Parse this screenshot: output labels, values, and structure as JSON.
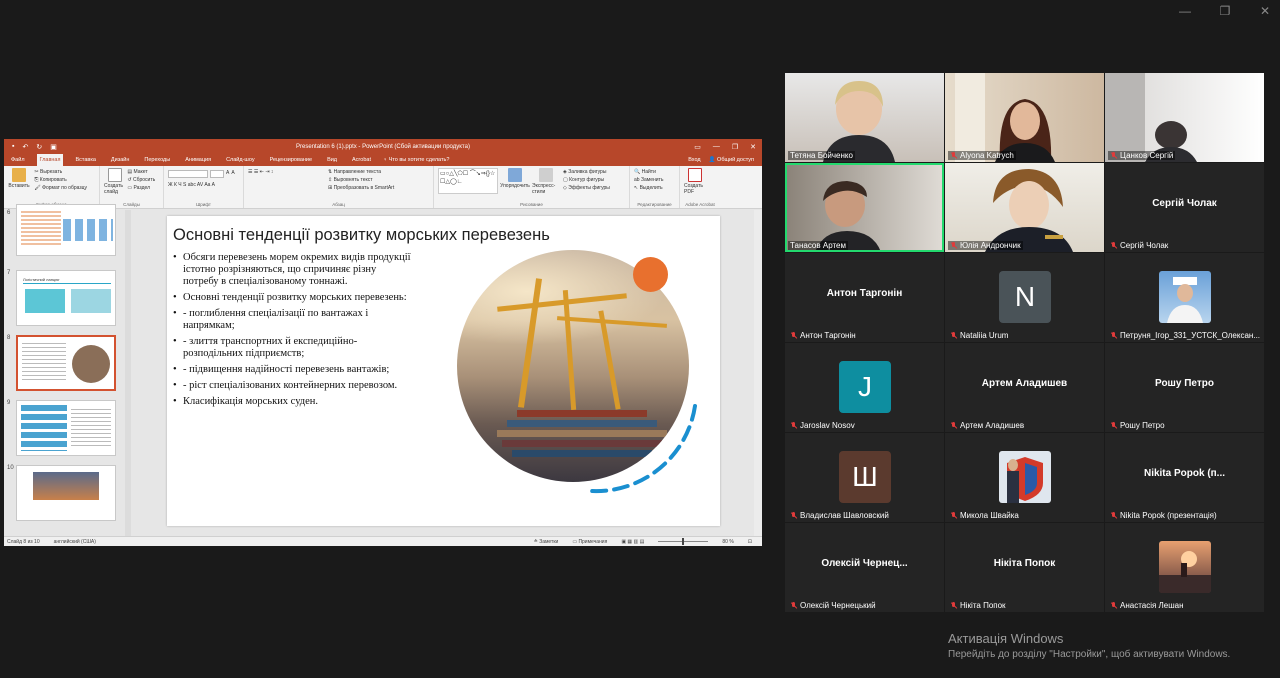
{
  "window": {
    "minimize": "—",
    "maximize": "❐",
    "close": "✕"
  },
  "ppt": {
    "title": "Presentation 6 (1).pptx - PowerPoint (Сбой активации продукта)",
    "menu_tabs": [
      "Файл",
      "Главная",
      "Вставка",
      "Дизайн",
      "Переходы",
      "Анимация",
      "Слайд-шоу",
      "Рецензирование",
      "Вид",
      "Acrobat"
    ],
    "active_tab": "Главная",
    "tell_me": "Что вы хотите сделать?",
    "login": "Вход",
    "share": "Общий доступ",
    "ribbon": {
      "paste": "Вставить",
      "cut": "Вырезать",
      "copy": "Копировать",
      "format_painter": "Формат по образцу",
      "clipboard_group": "Буфер обмена",
      "new_slide": "Создать слайд",
      "layout": "Макет",
      "reset": "Сбросить",
      "section": "Раздел",
      "slides_group": "Слайды",
      "font_group": "Шрифт",
      "text_direction": "Направление текста",
      "align_text": "Выровнять текст",
      "smartart": "Преобразовать в SmartArt",
      "paragraph_group": "Абзац",
      "arrange": "Упорядочить",
      "quick_styles": "Экспресс-стили",
      "shape_fill": "Заливка фигуры",
      "shape_outline": "Контур фигуры",
      "shape_effects": "Эффекты фигуры",
      "drawing_group": "Рисование",
      "find": "Найти",
      "replace": "Заменить",
      "select": "Выделить",
      "editing_group": "Редактирование",
      "create_pdf": "Создать PDF",
      "acrobat_group": "Adobe Acrobat"
    },
    "thumbs": [
      {
        "num": "7",
        "caption": "Логістичний ланцюг"
      },
      {
        "num": "8",
        "caption": ""
      },
      {
        "num": "9",
        "caption": ""
      },
      {
        "num": "10",
        "caption": ""
      }
    ],
    "slide": {
      "title": "Основні тенденції розвитку морських перевезень",
      "bullets": [
        "Обсяги перевезень морем окремих видів продукції істотно розрізняються, що спричиняє різну потребу в спеціалізованому тоннажі.",
        "Основні тенденції розвитку морських перевезень:",
        "- поглиблення спеціалізації по вантажах і напрямкам;",
        "- злиття транспортних й експедиційно-розподільних підприємств;",
        "- підвищення надійності перевезень вантажів;",
        "- ріст спеціалізованих контейнерних перевозом.",
        "Класифікація морських суден."
      ]
    },
    "status": {
      "slide_info": "Слайд 8 из 10",
      "language": "английский (США)",
      "notes": "Заметки",
      "comments": "Примечания",
      "zoom": "80 %"
    }
  },
  "participants": [
    {
      "name": "Тетяна Бойченко",
      "kind": "video",
      "muted": false
    },
    {
      "name": "Alyona Katrych",
      "kind": "video",
      "muted": false
    },
    {
      "name": "Цанков Сергій",
      "kind": "video",
      "muted": false
    },
    {
      "name": "Танасов Артем",
      "kind": "video",
      "muted": false,
      "speaking": true
    },
    {
      "name": "Юлія Андрончик",
      "kind": "video",
      "muted": true
    },
    {
      "name": "Сергій Чолак",
      "kind": "name",
      "big": "Сергій Чолак",
      "muted": false
    },
    {
      "name": "Антон Таргонін",
      "kind": "name",
      "big": "Антон Таргонін",
      "muted": true
    },
    {
      "name": "Nataliia Urum",
      "kind": "avatar",
      "initial": "N",
      "color": "#4a5358",
      "muted": true
    },
    {
      "name": "Петруня_Ігор_331_УСТСК_Олексан...",
      "kind": "photo",
      "muted": true
    },
    {
      "name": "Jaroslav Nosov",
      "kind": "avatar",
      "initial": "J",
      "color": "#0e8ea0",
      "muted": true
    },
    {
      "name": "Артем Аладишев",
      "kind": "name",
      "big": "Артем Аладишев",
      "muted": true
    },
    {
      "name": "Рошу Петро",
      "kind": "name",
      "big": "Рошу Петро",
      "muted": true
    },
    {
      "name": "Владислав Шавловский",
      "kind": "avatar",
      "initial": "Ш",
      "color": "#5b3a2e",
      "muted": true
    },
    {
      "name": "Микола Швайка",
      "kind": "photo",
      "muted": true
    },
    {
      "name": "Nikita Popok (презентація)",
      "kind": "name",
      "big": "Nikita Popok (п...",
      "muted": true
    },
    {
      "name": "Олексій Чернецький",
      "kind": "name",
      "big": "Олексій Чернец...",
      "muted": true
    },
    {
      "name": "Нікіта Попок",
      "kind": "name",
      "big": "Нікіта Попок",
      "muted": true
    },
    {
      "name": "Анастасія Лешан",
      "kind": "photo",
      "muted": true
    }
  ],
  "activation": {
    "title": "Активація Windows",
    "subtitle": "Перейдіть до розділу \"Настройки\", щоб активувати Windows."
  }
}
